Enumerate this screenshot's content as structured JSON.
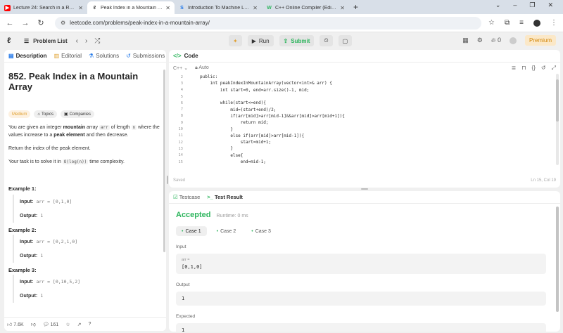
{
  "browser": {
    "tabs": [
      {
        "title": "Lecture 24: Search in a Rotated",
        "favicon": "youtube-icon",
        "color": "#ff0000"
      },
      {
        "title": "Peak Index in a Mountain Array",
        "favicon": "leetcode-icon",
        "color": "#333333",
        "active": true
      },
      {
        "title": "Introduction To Machine Learn",
        "favicon": "s-icon",
        "color": "#1a73e8"
      },
      {
        "title": "C++ Online Compiler (Editor /",
        "favicon": "w-icon",
        "color": "#2db55d"
      }
    ],
    "url": "leetcode.com/problems/peak-index-in-a-mountain-array/"
  },
  "header": {
    "problem_list": "Problem List",
    "run": "Run",
    "submit": "Submit",
    "fire_count": "0",
    "premium": "Premium"
  },
  "left": {
    "tabs": [
      "Description",
      "Editorial",
      "Solutions",
      "Submissions"
    ],
    "title": "852. Peak Index in a Mountain Array",
    "badges": [
      "Medium",
      "Topics",
      "Companies"
    ],
    "p1_a": "You are given an integer ",
    "p1_b": "mountain",
    "p1_c": " array ",
    "p1_d": "arr",
    "p1_e": " of length ",
    "p1_f": "n",
    "p1_g": " where the values increase to a ",
    "p1_h": "peak element",
    "p1_i": " and then decrease.",
    "p2": "Return the index of the peak element.",
    "p3_a": "Your task is to solve it in ",
    "p3_b": "O(log(n))",
    "p3_c": " time complexity.",
    "input_label": "Input:",
    "output_label": "Output:",
    "examples": [
      {
        "h": "Example 1:",
        "input": "arr = [0,1,0]",
        "output": "1"
      },
      {
        "h": "Example 2:",
        "input": "arr = [0,2,1,0]",
        "output": "1"
      },
      {
        "h": "Example 3:",
        "input": "arr = [0,10,5,2]",
        "output": "1"
      }
    ],
    "likes": "7.6K",
    "comments": "161"
  },
  "code": {
    "tab": "Code",
    "lang": "C++",
    "mode": "Auto",
    "lines": [
      {
        "n": "2",
        "t": "public:"
      },
      {
        "n": "3",
        "t": "    int peakIndexInMountainArray(vector<int>& arr) {"
      },
      {
        "n": "4",
        "t": "        int start=0, end=arr.size()-1, mid;"
      },
      {
        "n": "5",
        "t": ""
      },
      {
        "n": "6",
        "t": "        while(start<=end){"
      },
      {
        "n": "7",
        "t": "            mid=(start+end)/2;"
      },
      {
        "n": "8",
        "t": "            if(arr[mid]>arr[mid-1]&&arr[mid]>arr[mid+1]){"
      },
      {
        "n": "9",
        "t": "                return mid;"
      },
      {
        "n": "10",
        "t": "            }"
      },
      {
        "n": "11",
        "t": "            else if(arr[mid]>arr[mid-1]){"
      },
      {
        "n": "12",
        "t": "                start=mid+1;"
      },
      {
        "n": "13",
        "t": "            }"
      },
      {
        "n": "14",
        "t": "            else{"
      },
      {
        "n": "15",
        "t": "                end=mid-1;"
      }
    ],
    "saved": "Saved",
    "position": "Ln 15, Col 19"
  },
  "test": {
    "tab1": "Testcase",
    "tab2": "Test Result",
    "status": "Accepted",
    "runtime": "Runtime: 0 ms",
    "cases": [
      "Case 1",
      "Case 2",
      "Case 3"
    ],
    "input_label": "Input",
    "var_name": "arr =",
    "input_value": "[0,1,0]",
    "output_label": "Output",
    "output_value": "1",
    "expected_label": "Expected",
    "expected_value": "1"
  }
}
